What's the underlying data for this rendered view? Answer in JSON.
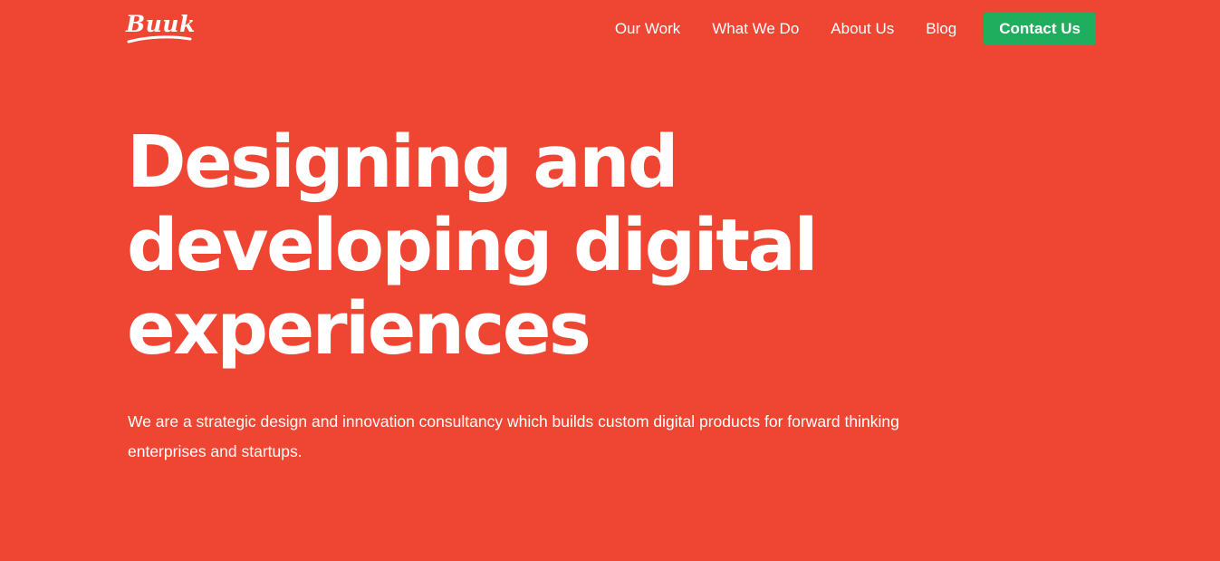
{
  "brand": {
    "logo_text": "Buuk"
  },
  "nav": {
    "items": [
      {
        "label": "Our Work"
      },
      {
        "label": "What We Do"
      },
      {
        "label": "About Us"
      },
      {
        "label": "Blog"
      }
    ],
    "cta_label": "Contact Us"
  },
  "hero": {
    "headline_lines": [
      "Designing and",
      "developing digital",
      "experiences"
    ],
    "subtitle": "We are a strategic design and innovation consultancy which builds custom digital products for forward thinking enterprises and startups."
  },
  "colors": {
    "background": "#EF4533",
    "cta_background": "#1FAD5E",
    "text": "#FFFFFF"
  }
}
